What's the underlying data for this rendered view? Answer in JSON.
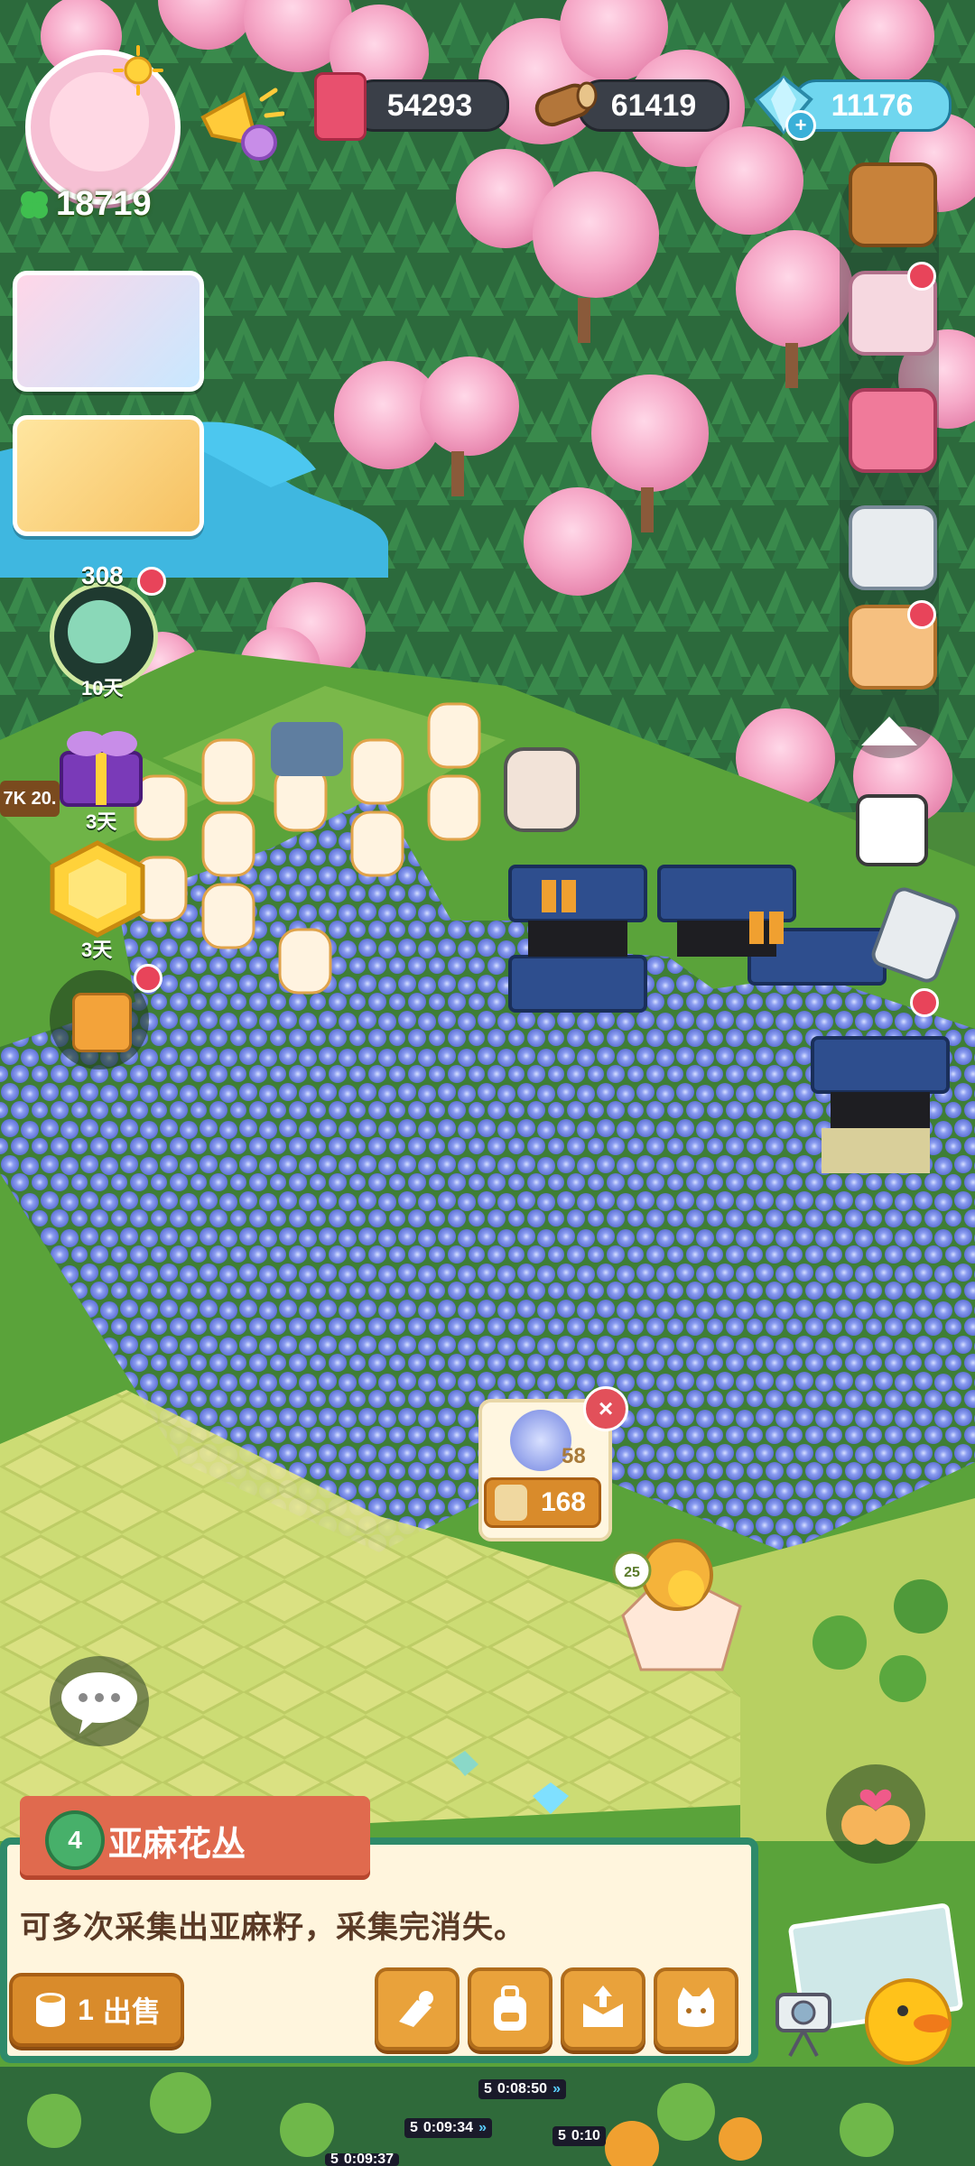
{
  "hud": {
    "clover": "18719",
    "resources": [
      {
        "name": "potion",
        "value": "54293",
        "color": "#e8506e"
      },
      {
        "name": "wood",
        "value": "61419",
        "color": "#a86b36"
      },
      {
        "name": "gem",
        "value": "11176",
        "color": "#5ad0e6"
      }
    ]
  },
  "left_widgets": {
    "event_count": "308",
    "event_days": "10天",
    "gift_days": "3天",
    "coin_days": "3天",
    "stock_label": "7K 20."
  },
  "popup": {
    "count": "58",
    "cost": "168"
  },
  "panel": {
    "level": "4",
    "title": "亚麻花丛",
    "description": "可多次采集出亚麻籽，采集完消失。",
    "sell_count": "1",
    "sell_label": "出售",
    "actions": [
      "harvest-icon",
      "backpack-icon",
      "store-icon",
      "cat-icon"
    ]
  },
  "timers": [
    {
      "level": "5",
      "time": "0:08:50"
    },
    {
      "level": "5",
      "time": "0:09:34"
    },
    {
      "level": "5",
      "time": "0:10"
    },
    {
      "level": "5",
      "time": "0:09:37"
    }
  ],
  "colors": {
    "grass": "#5aa33a",
    "flower": "#7b8ee8",
    "cherry": "#f4a9c6",
    "pine": "#2f7a45",
    "panel_border": "#2e8a6a",
    "title_red": "#e06a4e",
    "button_orange": "#d98b2b"
  }
}
